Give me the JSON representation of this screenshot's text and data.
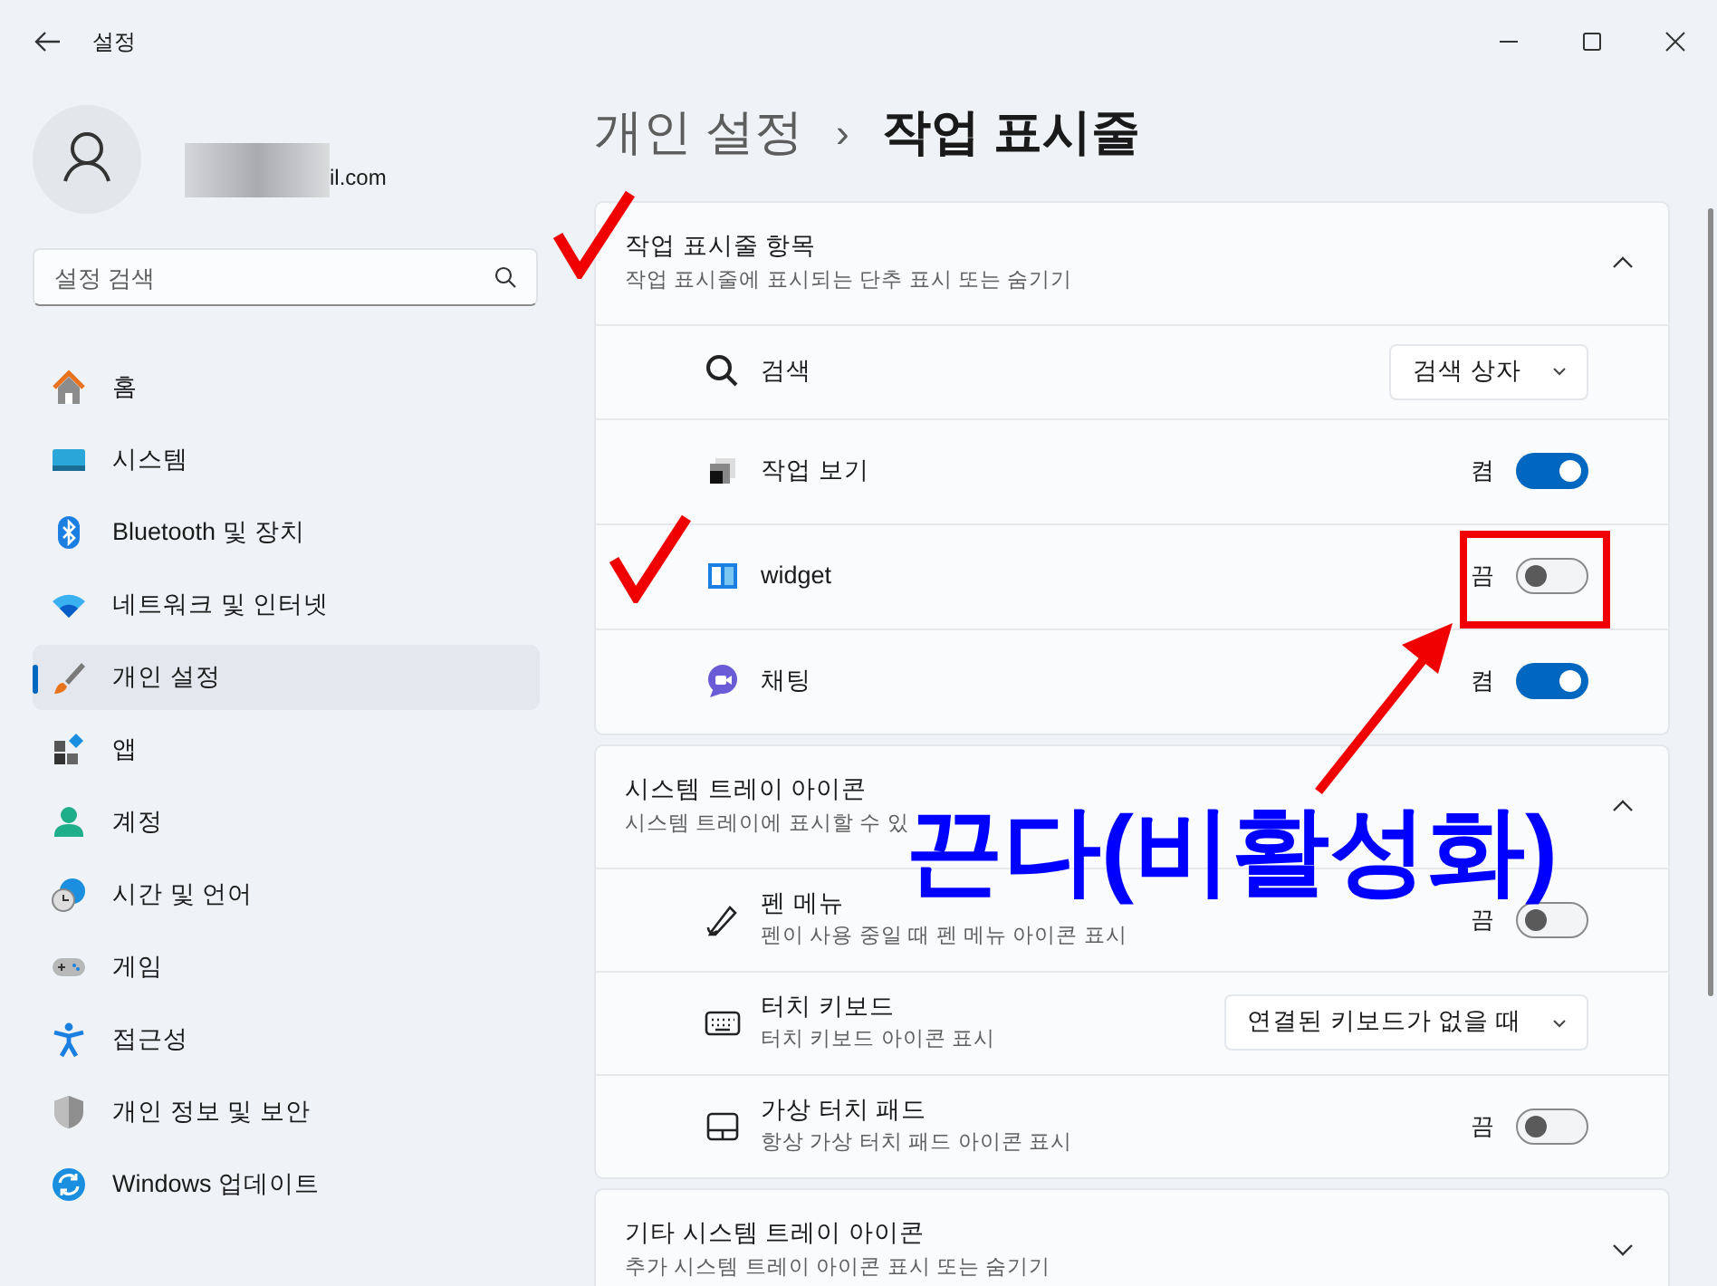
{
  "window": {
    "title": "설정"
  },
  "account": {
    "email": "il.com"
  },
  "search": {
    "placeholder": "설정 검색"
  },
  "sidebar": {
    "items": [
      {
        "label": "홈",
        "selected": false
      },
      {
        "label": "시스템",
        "selected": false
      },
      {
        "label": "Bluetooth 및 장치",
        "selected": false
      },
      {
        "label": "네트워크 및 인터넷",
        "selected": false
      },
      {
        "label": "개인 설정",
        "selected": true
      },
      {
        "label": "앱",
        "selected": false
      },
      {
        "label": "계정",
        "selected": false
      },
      {
        "label": "시간 및 언어",
        "selected": false
      },
      {
        "label": "게임",
        "selected": false
      },
      {
        "label": "접근성",
        "selected": false
      },
      {
        "label": "개인 정보 및 보안",
        "selected": false
      },
      {
        "label": "Windows 업데이트",
        "selected": false
      }
    ]
  },
  "breadcrumb": {
    "parent": "개인 설정",
    "separator": "›",
    "current": "작업 표시줄"
  },
  "sections": [
    {
      "title": "작업 표시줄 항목",
      "subtitle": "작업 표시줄에 표시되는 단추 표시 또는 숨기기",
      "expanded": true,
      "rows": [
        {
          "kind": "dropdown",
          "label": "검색",
          "value": "검색 상자"
        },
        {
          "kind": "toggle",
          "label": "작업 보기",
          "state": "켬",
          "on": true
        },
        {
          "kind": "toggle",
          "label": "widget",
          "state": "끔",
          "on": false
        },
        {
          "kind": "toggle",
          "label": "채팅",
          "state": "켬",
          "on": true
        }
      ]
    },
    {
      "title": "시스템 트레이 아이콘",
      "subtitle": "시스템 트레이에 표시할 수 있",
      "expanded": true,
      "rows": [
        {
          "kind": "toggle",
          "label": "펜 메뉴",
          "description": "펜이 사용 중일 때 펜 메뉴 아이콘 표시",
          "state": "끔",
          "on": false
        },
        {
          "kind": "dropdown",
          "label": "터치 키보드",
          "description": "터치 키보드 아이콘 표시",
          "value": "연결된 키보드가 없을 때"
        },
        {
          "kind": "toggle",
          "label": "가상 터치 패드",
          "description": "항상 가상 터치 패드 아이콘 표시",
          "state": "끔",
          "on": false
        }
      ]
    },
    {
      "title": "기타 시스템 트레이 아이콘",
      "subtitle": "추가 시스템 트레이 아이콘 표시 또는 숨기기",
      "expanded": false
    }
  ],
  "annotation": {
    "label": "끈다(비활성화)"
  }
}
